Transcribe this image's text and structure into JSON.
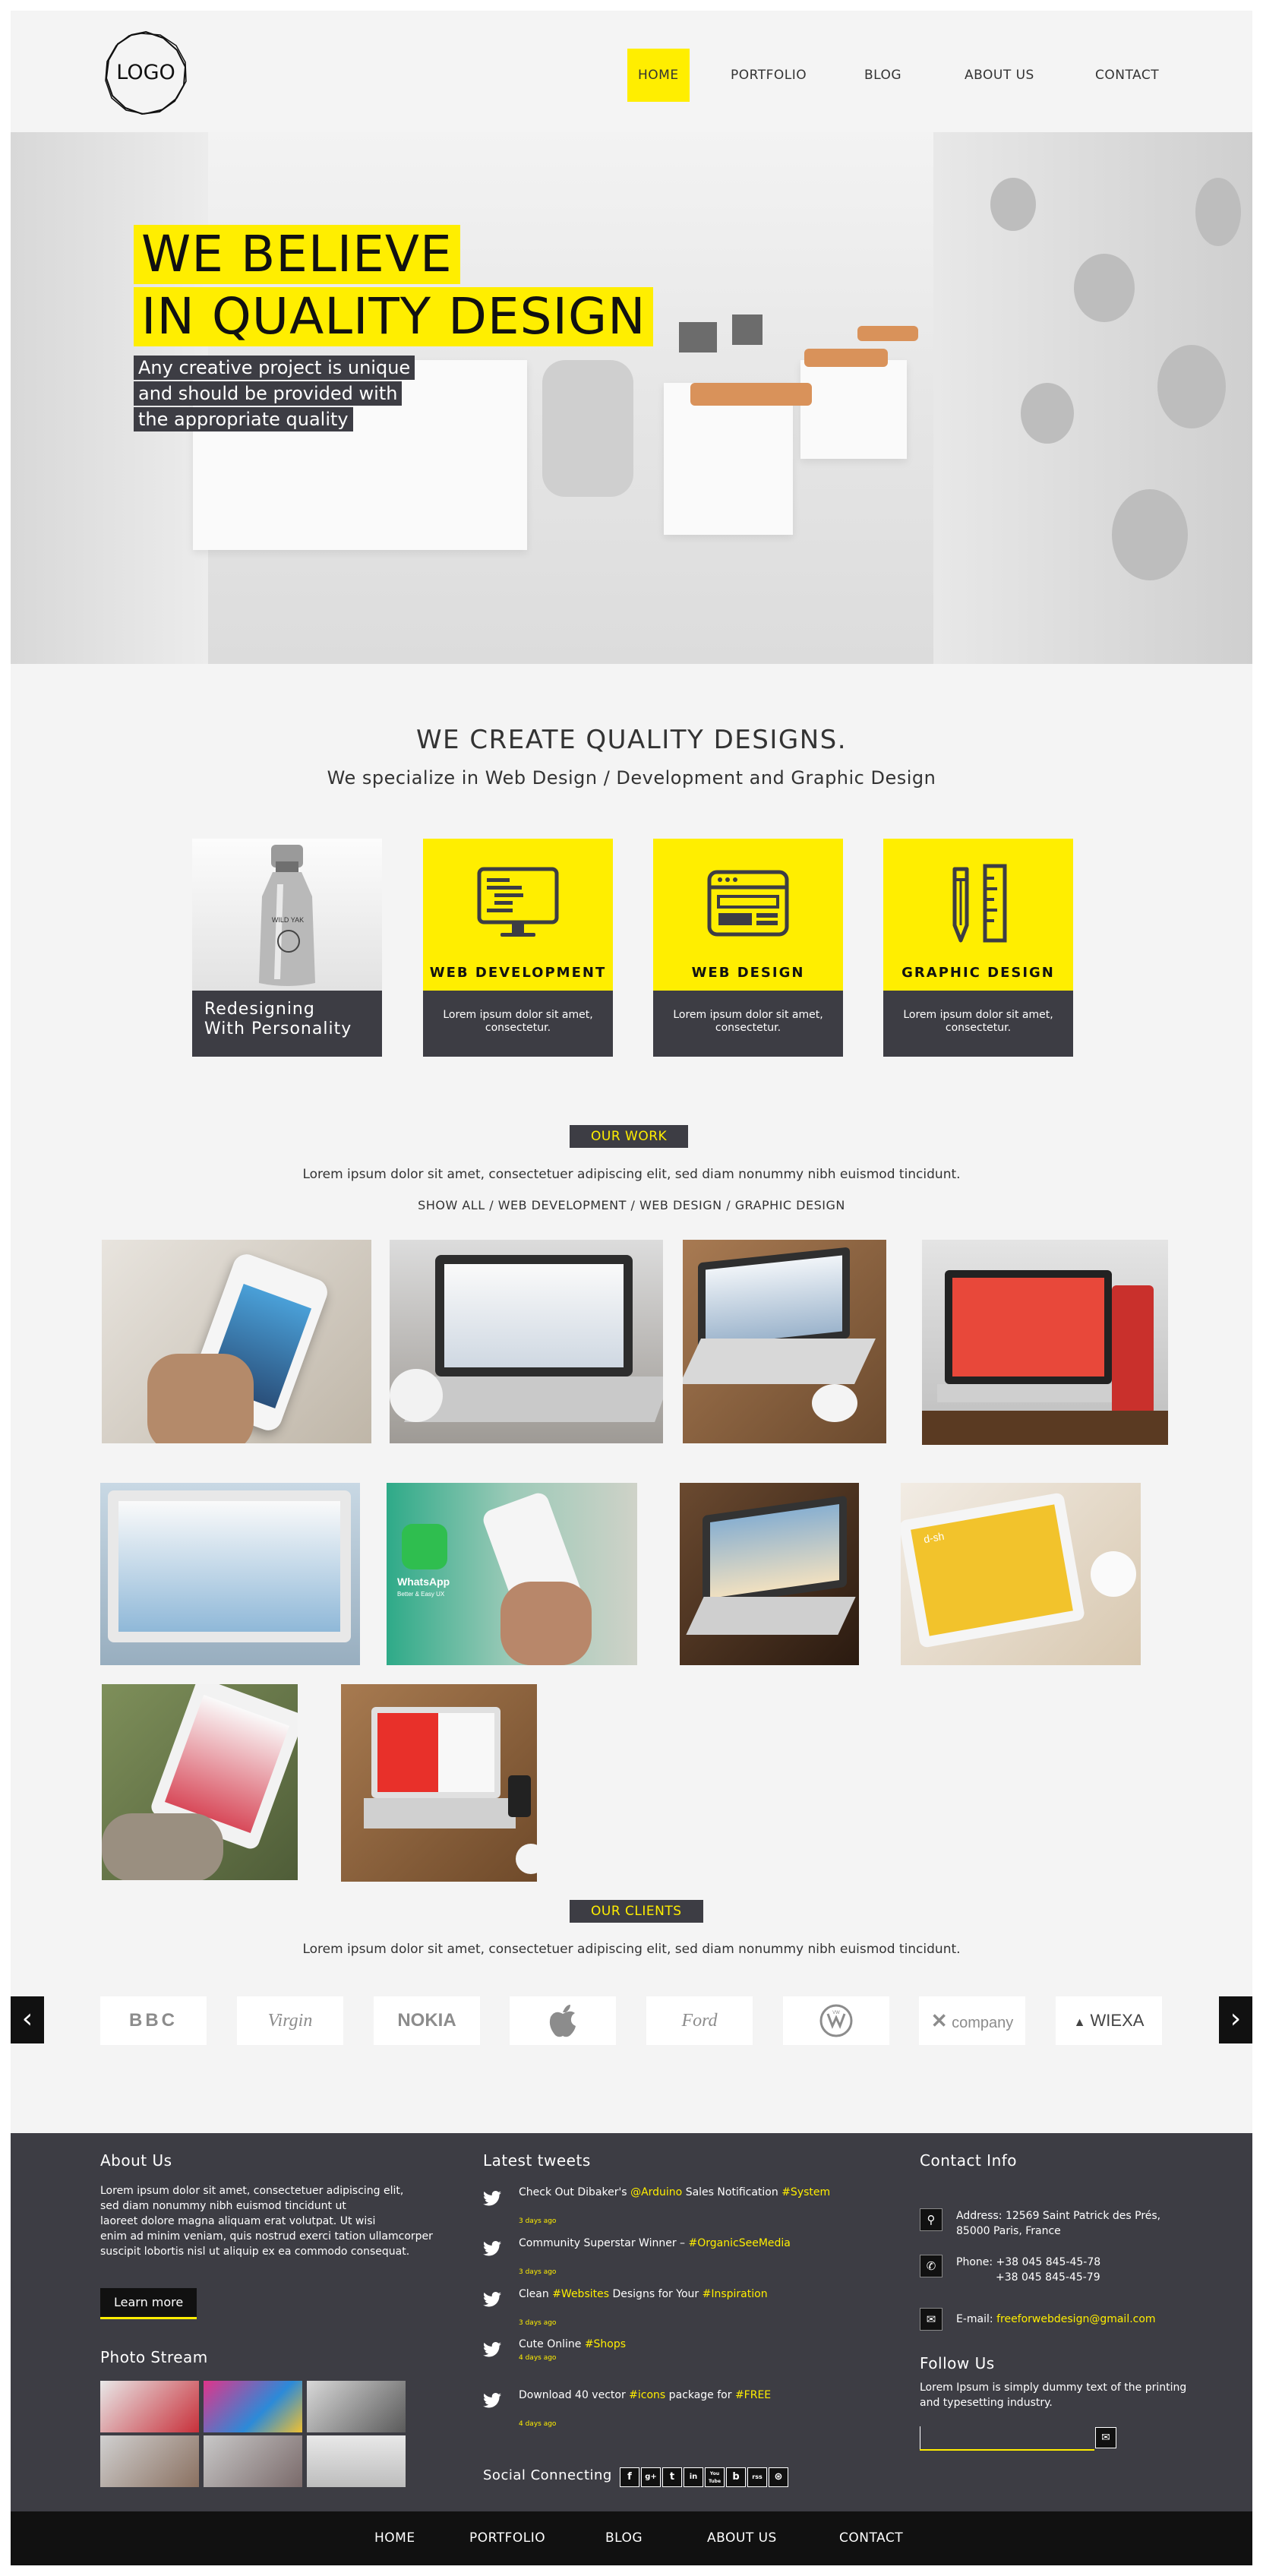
{
  "header": {
    "logo": "LOGO",
    "nav": [
      "HOME",
      "PORTFOLIO",
      "BLOG",
      "ABOUT US",
      "CONTACT"
    ]
  },
  "hero": {
    "line1": "WE BELIEVE",
    "line2": "IN QUALITY DESIGN",
    "sub": [
      "Any creative project is unique",
      "and should be provided with",
      "the appropriate quality"
    ]
  },
  "services": {
    "title": "WE CREATE QUALITY DESIGNS.",
    "subtitle": "We specialize in Web Design / Development and Graphic Design",
    "feature_label": [
      "Redesigning",
      "With Personality"
    ],
    "feature_bottle_text": "WILD YAK",
    "cards": [
      {
        "title": "WEB DEVELOPMENT",
        "text": [
          "Lorem ipsum dolor sit amet,",
          "consectetur."
        ],
        "icon": "monitor-code-icon"
      },
      {
        "title": "WEB DESIGN",
        "text": [
          "Lorem ipsum dolor sit amet,",
          "consectetur."
        ],
        "icon": "browser-window-icon"
      },
      {
        "title": "GRAPHIC DESIGN",
        "text": [
          "Lorem ipsum dolor sit amet,",
          "consectetur."
        ],
        "icon": "pencil-ruler-icon"
      }
    ]
  },
  "work": {
    "tag": "OUR WORK",
    "text": "Lorem ipsum dolor sit amet, consectetuer adipiscing elit, sed diam nonummy nibh euismod tincidunt.",
    "filters": [
      "SHOW ALL",
      "WEB DEVELOPMENT",
      "WEB DESIGN",
      "GRAPHIC DESIGN"
    ],
    "filter_sep": " / ",
    "whatsapp": "WhatsApp",
    "whatsapp_sub": "Better & Easy UX",
    "dash_brand": "d-sh"
  },
  "clients": {
    "tag": "OUR CLIENTS",
    "text": "Lorem ipsum dolor sit amet, consectetuer adipiscing elit, sed diam nonummy nibh euismod tincidunt.",
    "prev": "‹",
    "next": "›",
    "logos": [
      "BBC",
      "Virgin",
      "NOKIA",
      "",
      "Ford",
      "VW",
      "company",
      "WIEXA"
    ]
  },
  "footer": {
    "about_title": "About Us",
    "about_text": [
      "Lorem ipsum dolor sit amet, consectetuer adipiscing elit,",
      "sed diam nonummy nibh euismod tincidunt ut",
      "laoreet dolore magna aliquam erat volutpat. Ut wisi",
      "enim ad minim veniam, quis nostrud exerci tation ullamcorper",
      "suscipit lobortis nisl ut aliquip ex ea commodo consequat."
    ],
    "learn_more": "Learn more",
    "photo_title": "Photo Stream",
    "tweets_title": "Latest tweets",
    "tweets": [
      {
        "a": "Check Out Dibaker's ",
        "h1": "@Arduino",
        "b": " Sales Notification ",
        "h2": "#System",
        "time": "3 days ago"
      },
      {
        "a": "Community Superstar Winner – ",
        "h1": "#OrganicSeeMedia",
        "b": "",
        "h2": "",
        "time": "3 days ago"
      },
      {
        "a": "Clean ",
        "h1": "#Websites",
        "b": " Designs for Your ",
        "h2": "#Inspiration",
        "time": "3 days ago"
      },
      {
        "a": "Cute Online ",
        "h1": "#Shops",
        "b": "",
        "h2": "",
        "time": "4 days ago"
      },
      {
        "a": "Download 40 vector ",
        "h1": "#icons",
        "b": " package for ",
        "h2": "#FREE",
        "time": "4 days ago"
      }
    ],
    "social_title": "Social Connecting",
    "social": [
      "f",
      "g+",
      "t",
      "in",
      "You Tube",
      "b",
      "rss",
      "⊛"
    ],
    "contact_title": "Contact Info",
    "address_label": "Address:",
    "address": [
      "12569 Saint Patrick des Prés,",
      "85000 Paris, France"
    ],
    "phone_label": "Phone:",
    "phones": [
      "+38 045 845-45-78",
      "+38 045 845-45-79"
    ],
    "email_label": "E-mail:",
    "email": "freeforwebdesign@gmail.com",
    "follow_title": "Follow Us",
    "follow_text": [
      "Lorem Ipsum is simply dummy text of the printing",
      "and typesetting industry."
    ],
    "subscribe_placeholder": ""
  },
  "bottom_nav": [
    "HOME",
    "PORTFOLIO",
    "BLOG",
    "ABOUT US",
    "CONTACT"
  ],
  "colors": {
    "accent": "#ffee00",
    "dark": "#3d3d44",
    "black": "#111111",
    "background": "#f4f4f4"
  }
}
